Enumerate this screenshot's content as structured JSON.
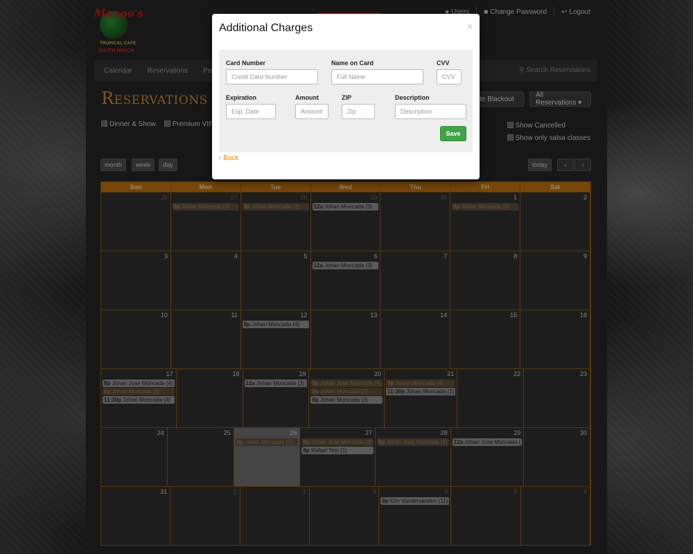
{
  "brand": {
    "name": "Mango's",
    "line1": "TROPICAL CAFE",
    "line2": "SOUTH BEACH"
  },
  "topnav": {
    "users": "Users",
    "change_password": "Change Password",
    "logout": "Logout"
  },
  "navbar": {
    "items": [
      "Calendar",
      "Reservations",
      "Paym"
    ],
    "search": "Search Reservations"
  },
  "page": {
    "title": "Reservations"
  },
  "buttons": {
    "create_blackout": "eate Blackout",
    "all_reservations": "All Reservations ▾"
  },
  "filters": {
    "dinner_show": "Dinner & Show",
    "premium_vip": "Premium VIP Ser",
    "show_cancelled": "Show Cancelled",
    "show_salsa": "Show only salsa classes"
  },
  "views": {
    "month": "month",
    "week": "week",
    "day": "day",
    "today": "today",
    "prev": "‹",
    "next": "›"
  },
  "calendar": {
    "days": [
      "Sun",
      "Mon",
      "Tue",
      "Wed",
      "Thu",
      "Fri",
      "Sat"
    ],
    "weeks": [
      [
        {
          "n": "26",
          "o": true
        },
        {
          "n": "27",
          "o": true,
          "ev": [
            {
              "t": "8p",
              "x": "Johan Moncada (3)",
              "s": "dim"
            }
          ]
        },
        {
          "n": "28",
          "o": true,
          "ev": [
            {
              "t": "8p",
              "x": "Johan Moncada (3)",
              "s": "dim"
            }
          ]
        },
        {
          "n": "29",
          "o": true,
          "ev": [
            {
              "t": "12a",
              "x": "Johan Moncada (3)",
              "s": "grey"
            }
          ]
        },
        {
          "n": "30",
          "o": true
        },
        {
          "n": "1",
          "ev": [
            {
              "t": "8p",
              "x": "Johan Moncada (3)",
              "s": "dim"
            }
          ]
        },
        {
          "n": "2"
        }
      ],
      [
        {
          "n": "3"
        },
        {
          "n": "4"
        },
        {
          "n": "5"
        },
        {
          "n": "6",
          "ev": [
            {
              "t": "12a",
              "x": "Johan Moncada (3)",
              "s": "grey"
            }
          ]
        },
        {
          "n": "7"
        },
        {
          "n": "8"
        },
        {
          "n": "9"
        }
      ],
      [
        {
          "n": "10"
        },
        {
          "n": "11"
        },
        {
          "n": "12",
          "ev": [
            {
              "t": "8p",
              "x": "Johan Moncada (4)",
              "s": "grey"
            }
          ]
        },
        {
          "n": "13"
        },
        {
          "n": "14"
        },
        {
          "n": "15"
        },
        {
          "n": "16"
        }
      ],
      [
        {
          "n": "17",
          "ev": [
            {
              "t": "8p",
              "x": "Johan Jose Moncada (4)",
              "s": "grey"
            },
            {
              "t": "8p",
              "x": "Johan Moncada (5)",
              "s": "dim"
            },
            {
              "t": "11:30p",
              "x": "Johan Moncada (4)",
              "s": "grey"
            }
          ]
        },
        {
          "n": "18"
        },
        {
          "n": "19",
          "ev": [
            {
              "t": "12a",
              "x": "Johan Moncada (3)",
              "s": "grey"
            }
          ]
        },
        {
          "n": "20",
          "ev": [
            {
              "t": "8p",
              "x": "Johan Jose Moncada (4)",
              "s": "dim"
            },
            {
              "t": "8p",
              "x": "Johan Moncada (2)",
              "s": "dim"
            },
            {
              "t": "8p",
              "x": "Johan Moncada (3)",
              "s": "grey"
            }
          ]
        },
        {
          "n": "21",
          "ev": [
            {
              "t": "8p",
              "x": "Johan Moncada (4)",
              "s": "dim"
            },
            {
              "t": "11:30p",
              "x": "Johan Moncada (2)",
              "s": "grey"
            }
          ]
        },
        {
          "n": "22"
        },
        {
          "n": "23"
        }
      ],
      [
        {
          "n": "24"
        },
        {
          "n": "25"
        },
        {
          "n": "26",
          "today": true,
          "ev": [
            {
              "t": "8p",
              "x": "Johan Moncada (2)",
              "s": "dim"
            }
          ]
        },
        {
          "n": "27",
          "ev": [
            {
              "t": "8p",
              "x": "Johan Jose Moncada (3)",
              "s": "dim"
            },
            {
              "t": "8p",
              "x": "Rafael Test (1)",
              "s": "grey"
            }
          ]
        },
        {
          "n": "28",
          "ev": [
            {
              "t": "8p",
              "x": "Johan Jose Moncada (4)",
              "s": "dim"
            }
          ]
        },
        {
          "n": "29",
          "ev": [
            {
              "t": "12a",
              "x": "Johan Jose Moncada (",
              "s": "grey"
            }
          ]
        },
        {
          "n": "30"
        }
      ],
      [
        {
          "n": "31"
        },
        {
          "n": "1",
          "o": true
        },
        {
          "n": "2",
          "o": true
        },
        {
          "n": "3",
          "o": true
        },
        {
          "n": "4",
          "o": true,
          "ev": [
            {
              "t": "8p",
              "x": "Kim Vandersanden (11)",
              "s": "grey"
            }
          ]
        },
        {
          "n": "5",
          "o": true
        },
        {
          "n": "6",
          "o": true
        }
      ]
    ]
  },
  "modal": {
    "title": "Additional Charges",
    "close": "×",
    "card_number_label": "Card Number",
    "card_number_placeholder": "Credit Card Number",
    "name_label": "Name on Card",
    "name_placeholder": "Full Name",
    "cvv_label": "CVV",
    "cvv_placeholder": "CVV",
    "expiration_label": "Expiration",
    "expiration_placeholder": "Exp. Date",
    "amount_label": "Amount",
    "amount_placeholder": "Amount",
    "zip_label": "ZIP",
    "zip_placeholder": "Zip",
    "description_label": "Description",
    "description_placeholder": "Description",
    "save": "Save",
    "back": "Back"
  }
}
